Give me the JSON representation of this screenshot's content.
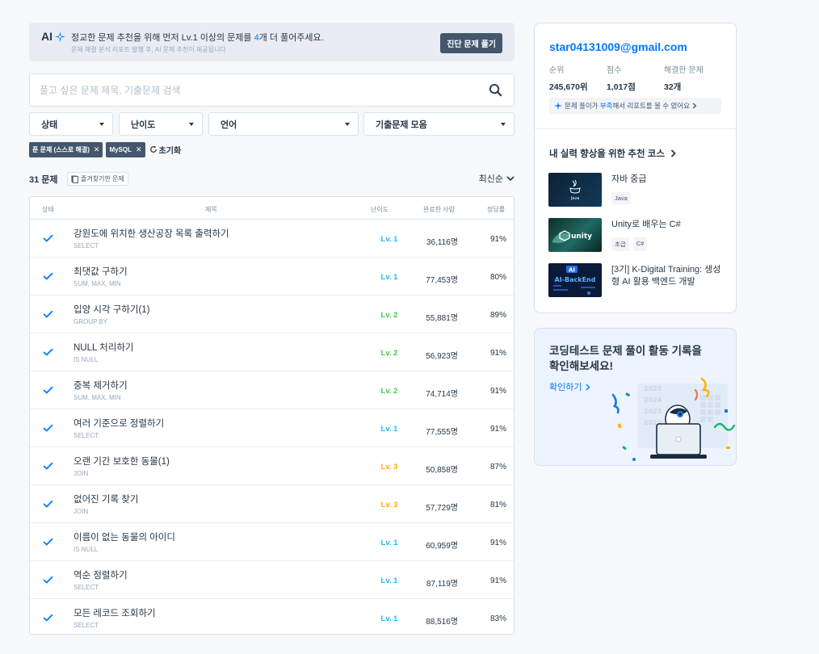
{
  "banner": {
    "ai_label": "AI",
    "title_prefix": "정교한 문제 추천을 위해 먼저 Lv.1 이상의 문제를 ",
    "title_count": "4",
    "title_suffix": "개 더 풀어주세요.",
    "subtitle": "문제 해결 분석 리포트 발행 후, AI 문제 추천이 제공됩니다",
    "button_label": "진단 문제 풀기"
  },
  "search": {
    "placeholder": "풀고 싶은 문제 제목, 기출문제 검색",
    "value": ""
  },
  "filters": [
    "상태",
    "난이도",
    "언어",
    "기출문제 모음"
  ],
  "active_chips": [
    "푼 문제 (스스로 해결)",
    "MySQL"
  ],
  "reset_label": "초기화",
  "list_header": {
    "count": "31 문제",
    "favorites_label": "즐겨찾기한 문제",
    "sort_label": "최신순"
  },
  "table": {
    "columns": [
      "상태",
      "제목",
      "난이도",
      "완료한 사람",
      "정답률"
    ],
    "rows": [
      {
        "title": "강원도에 위치한 생산공장 목록 출력하기",
        "tag": "SELECT",
        "level": "Lv. 1",
        "done": "36,116명",
        "rate": "91%"
      },
      {
        "title": "최댓값 구하기",
        "tag": "SUM, MAX, MIN",
        "level": "Lv. 1",
        "done": "77,453명",
        "rate": "80%"
      },
      {
        "title": "입양 시각 구하기(1)",
        "tag": "GROUP BY",
        "level": "Lv. 2",
        "done": "55,881명",
        "rate": "89%"
      },
      {
        "title": "NULL 처리하기",
        "tag": "IS NULL",
        "level": "Lv. 2",
        "done": "56,923명",
        "rate": "91%"
      },
      {
        "title": "중복 제거하기",
        "tag": "SUM, MAX, MIN",
        "level": "Lv. 2",
        "done": "74,714명",
        "rate": "91%"
      },
      {
        "title": "여러 기준으로 정렬하기",
        "tag": "SELECT",
        "level": "Lv. 1",
        "done": "77,555명",
        "rate": "91%"
      },
      {
        "title": "오랜 기간 보호한 동물(1)",
        "tag": "JOIN",
        "level": "Lv. 3",
        "done": "50,858명",
        "rate": "87%"
      },
      {
        "title": "없어진 기록 찾기",
        "tag": "JOIN",
        "level": "Lv. 3",
        "done": "57,729명",
        "rate": "81%"
      },
      {
        "title": "이름이 없는 동물의 아이디",
        "tag": "IS NULL",
        "level": "Lv. 1",
        "done": "60,959명",
        "rate": "91%"
      },
      {
        "title": "역순 정렬하기",
        "tag": "SELECT",
        "level": "Lv. 1",
        "done": "87,119명",
        "rate": "91%"
      },
      {
        "title": "모든 레코드 조회하기",
        "tag": "SELECT",
        "level": "Lv. 1",
        "done": "88,516명",
        "rate": "83%"
      }
    ]
  },
  "level_colors": {
    "Lv. 1": "#1bbaff",
    "Lv. 2": "#47c84c",
    "Lv. 3": "#ffa800"
  },
  "profile": {
    "email": "star04131009@gmail.com",
    "stats": [
      {
        "label": "순위",
        "value": "245,670위"
      },
      {
        "label": "점수",
        "value": "1,017점"
      },
      {
        "label": "해결한 문제",
        "value": "32개"
      }
    ],
    "report_prefix": "문제 풀이가 ",
    "report_highlight": "부족",
    "report_suffix": "해서 리포트를 볼 수 없어요",
    "courses_title": "내 실력 향상을 위한 추천 코스",
    "courses": [
      {
        "name": "자바 중급",
        "tags": [
          "Java"
        ],
        "thumb_text": "Java"
      },
      {
        "name": "Unity로 배우는 C#",
        "tags": [
          "초급",
          "C#"
        ],
        "thumb_text": "unity"
      },
      {
        "name": "[3기] K-Digital Training: 생성형 AI 활용 백엔드 개발",
        "tags": [],
        "thumb_text": "AI-BackEnd"
      }
    ]
  },
  "activity": {
    "title": "코딩테스트 문제 풀이 활동 기록을 확인해보세요!",
    "link_label": "확인하기",
    "years": [
      "2025",
      "2024",
      "2023",
      "2022"
    ]
  },
  "colors": {
    "accent": "#0078ff",
    "dark_button": "#44576c",
    "check": "#0078ff"
  }
}
